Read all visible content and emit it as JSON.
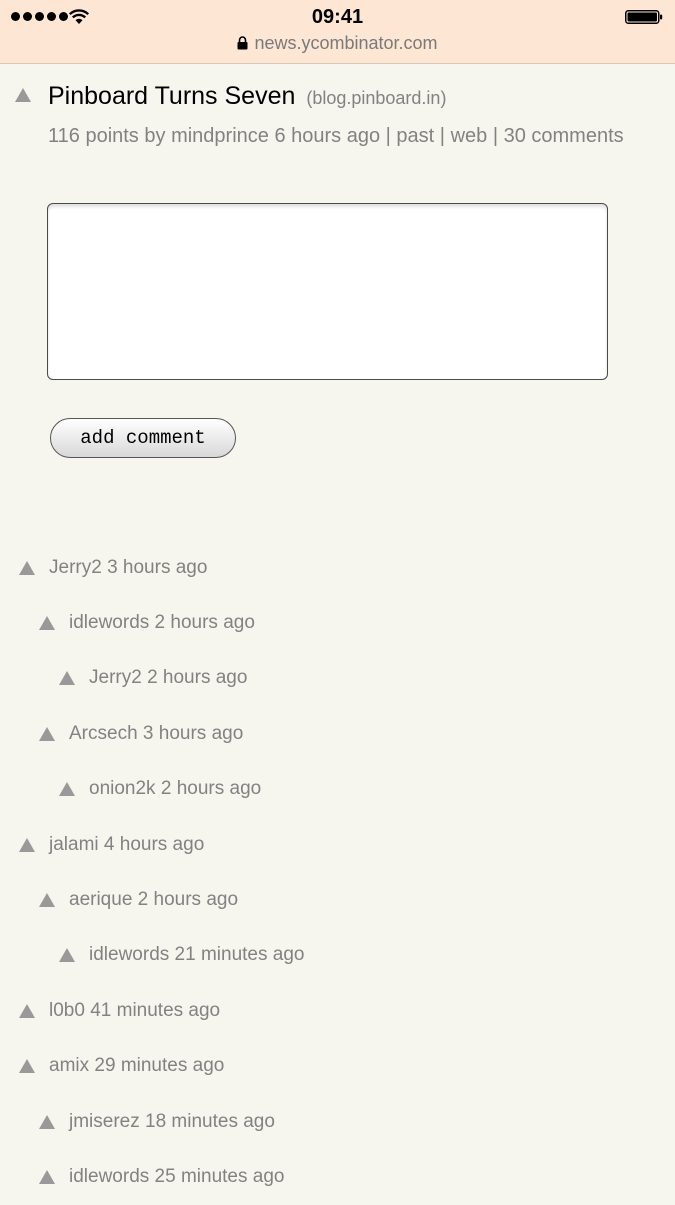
{
  "status_bar": {
    "time": "09:41",
    "url": "news.ycombinator.com"
  },
  "story": {
    "title": "Pinboard Turns Seven",
    "domain": "(blog.pinboard.in)",
    "points": "116 points",
    "by_label": "by",
    "user": "mindprince",
    "age": "6 hours ago",
    "separator": "|",
    "past_label": "past",
    "web_label": "web",
    "comments_label": "30 comments"
  },
  "form": {
    "comment_value": "",
    "submit_label": "add comment"
  },
  "comments": [
    {
      "user": "Jerry2",
      "age": "3 hours ago",
      "depth": 0
    },
    {
      "user": "idlewords",
      "age": "2 hours ago",
      "depth": 1
    },
    {
      "user": "Jerry2",
      "age": "2 hours ago",
      "depth": 2
    },
    {
      "user": "Arcsech",
      "age": "3 hours ago",
      "depth": 1
    },
    {
      "user": "onion2k",
      "age": "2 hours ago",
      "depth": 2
    },
    {
      "user": "jalami",
      "age": "4 hours ago",
      "depth": 0
    },
    {
      "user": "aerique",
      "age": "2 hours ago",
      "depth": 1
    },
    {
      "user": "idlewords",
      "age": "21 minutes ago",
      "depth": 2
    },
    {
      "user": "l0b0",
      "age": "41 minutes ago",
      "depth": 0
    },
    {
      "user": "amix",
      "age": "29 minutes ago",
      "depth": 0
    },
    {
      "user": "jmiserez",
      "age": "18 minutes ago",
      "depth": 1
    },
    {
      "user": "idlewords",
      "age": "25 minutes ago",
      "depth": 1
    }
  ],
  "icons": {
    "signal": "signal-dots-icon",
    "wifi": "wifi-icon",
    "battery": "battery-icon",
    "lock": "lock-icon",
    "upvote": "upvote-triangle-icon"
  },
  "colors": {
    "background": "#f6f6ef",
    "status_bar": "#fde6d4",
    "meta_text": "#828282",
    "vote_arrow": "#999999"
  }
}
